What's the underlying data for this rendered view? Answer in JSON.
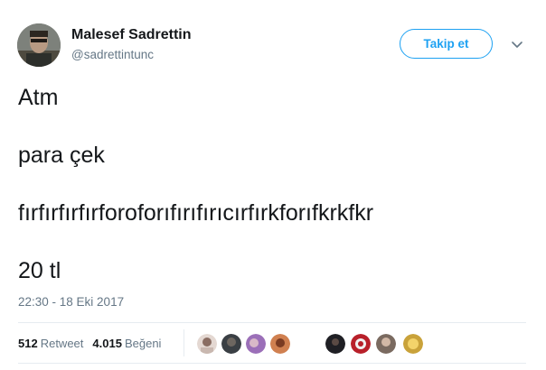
{
  "user": {
    "display_name": "Malesef Sadrettin",
    "handle": "@sadrettintunc",
    "avatar_icon": "profile-photo"
  },
  "follow_button": {
    "label": "Takip et",
    "accent": "#1da1f2"
  },
  "menu_icon": "chevron-down-icon",
  "tweet": {
    "lines": [
      "Atm",
      "para çek",
      "fırfırfırfırforoforıfırıfırıcırfırkforıfkrkfkr",
      "20 tl"
    ],
    "timestamp": "22:30 - 18 Eki 2017"
  },
  "stats": {
    "retweets": {
      "count": "512",
      "label": "Retweet"
    },
    "likes": {
      "count": "4.015",
      "label": "Beğeni"
    }
  },
  "likers": [
    {
      "name": "liker-avatar-1",
      "color": "#c9b8b0"
    },
    {
      "name": "liker-avatar-2",
      "color": "#3a3f44"
    },
    {
      "name": "liker-avatar-3",
      "color": "#9b6fb8"
    },
    {
      "name": "liker-avatar-4",
      "color": "#d08050"
    },
    {
      "name": "liker-avatar-5",
      "color": "#1f1f24"
    },
    {
      "name": "liker-avatar-6",
      "color": "#b8202a"
    },
    {
      "name": "liker-avatar-7",
      "color": "#7a6a60"
    },
    {
      "name": "liker-avatar-8",
      "color": "#c9a23a"
    }
  ],
  "colors": {
    "text_primary": "#14171a",
    "text_secondary": "#657786",
    "divider": "#e6ecf0"
  }
}
